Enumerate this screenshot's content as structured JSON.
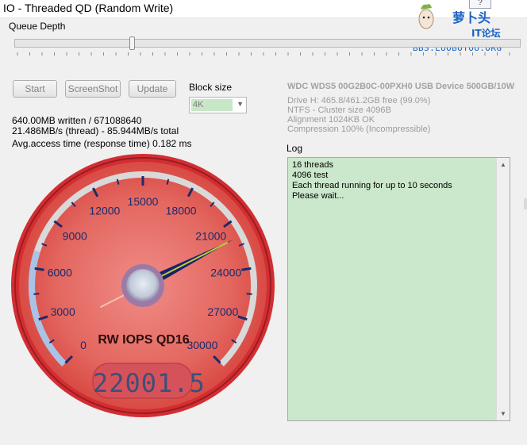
{
  "window": {
    "title": "IO - Threaded QD (Random Write)",
    "help_label": "?"
  },
  "logo": {
    "main": "萝卜头",
    "sub": "IT论坛",
    "url": "BBS.LUOBOTOU.ORG"
  },
  "queue": {
    "label": "Queue Depth"
  },
  "buttons": {
    "start": "Start",
    "screenshot": "ScreenShot",
    "update": "Update"
  },
  "block": {
    "label": "Block size",
    "value": "4K"
  },
  "stats": {
    "written": "640.00MB written / 671088640",
    "speed": "21.486MB/s (thread) - 85.944MB/s total",
    "access": "Avg.access time (response time) 0.182 ms"
  },
  "device": {
    "title": "WDC WDS5 00G2B0C-00PXH0 USB Device 500GB/10W",
    "drive": "Drive H: 465.8/461.2GB free (99.0%)",
    "fs": "NTFS - Cluster size 4096B",
    "align": "Alignment 1024KB OK",
    "compression": "Compression 100% (Incompressible)"
  },
  "log": {
    "label": "Log",
    "lines": [
      "16 threads",
      "4096 test",
      "Each thread running for up to 10 seconds",
      "Please wait..."
    ]
  },
  "gauge": {
    "title": "RW IOPS QD16",
    "readout": "22001.5",
    "scale": [
      "0",
      "3000",
      "6000",
      "9000",
      "12000",
      "15000",
      "18000",
      "21000",
      "24000",
      "27000",
      "30000"
    ],
    "min": 0,
    "max": 30000,
    "value": 22001.5,
    "colors": {
      "face": "#e86a63",
      "rim": "#c8202a",
      "needle": "#1b1f6b",
      "accent": "#b4d232"
    }
  }
}
